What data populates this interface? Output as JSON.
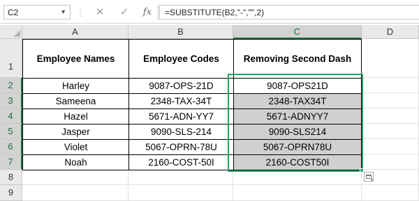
{
  "formula_bar": {
    "name_box": "C2",
    "separator": "⋮",
    "cancel_icon": "✕",
    "enter_icon": "✓",
    "function_icon": "fx",
    "formula": "=SUBSTITUTE(B2,\"-\",\"\",2)"
  },
  "columns": [
    "A",
    "B",
    "C",
    "D"
  ],
  "rows": [
    "1",
    "2",
    "3",
    "4",
    "5",
    "6",
    "7",
    "8",
    "9"
  ],
  "table": {
    "headers": [
      "Employee Names",
      "Employee Codes",
      "Removing Second Dash"
    ],
    "rows": [
      {
        "name": "Harley",
        "code": "9087-OPS-21D",
        "result": "9087-OPS21D"
      },
      {
        "name": "Sameena",
        "code": "2348-TAX-34T",
        "result": "2348-TAX34T"
      },
      {
        "name": "Hazel",
        "code": "5671-ADN-YY7",
        "result": "5671-ADNYY7"
      },
      {
        "name": "Jasper",
        "code": "9090-SLS-214",
        "result": "9090-SLS214"
      },
      {
        "name": "Violet",
        "code": "5067-OPRN-78U",
        "result": "5067-OPRN78U"
      },
      {
        "name": "Noah",
        "code": "2160-COST-50I",
        "result": "2160-COST50I"
      }
    ]
  },
  "colors": {
    "selection_border": "#21a366",
    "selected_header_text": "#1e6b3f",
    "shaded_fill": "#d0d0d0"
  }
}
